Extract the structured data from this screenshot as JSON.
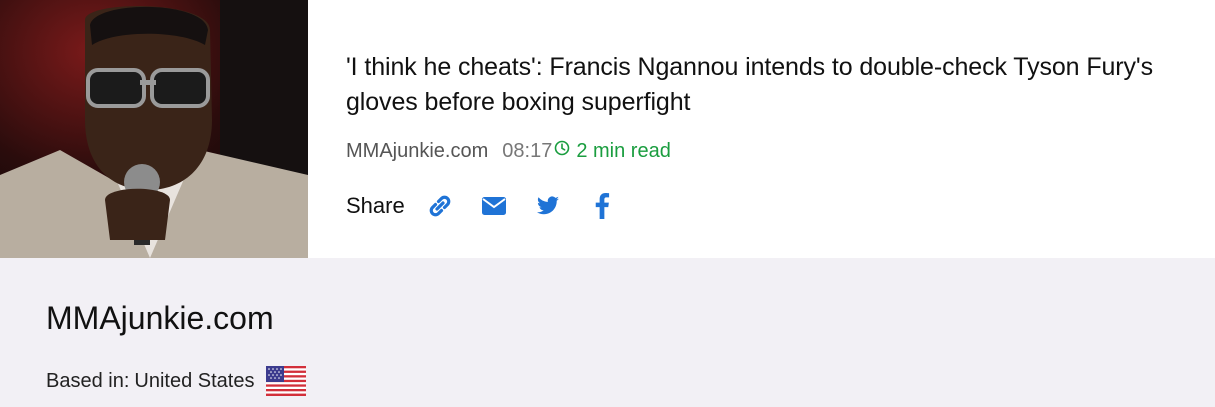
{
  "article": {
    "headline": "'I think he cheats': Francis Ngannou intends to double-check Tyson Fury's gloves before boxing superfight",
    "source": "MMAjunkie.com",
    "time": "08:17",
    "read_time": "2 min read",
    "share": {
      "label": "Share",
      "icons": [
        "link-icon",
        "email-icon",
        "twitter-icon",
        "facebook-icon"
      ]
    }
  },
  "source_info": {
    "name": "MMAjunkie.com",
    "based_in_label": "Based in:",
    "country": "United States",
    "flag_icon": "us-flag-icon"
  },
  "colors": {
    "accent_blue": "#1f73d6",
    "read_time_green": "#1a9d3f",
    "panel_bg": "#f2f0f5"
  }
}
